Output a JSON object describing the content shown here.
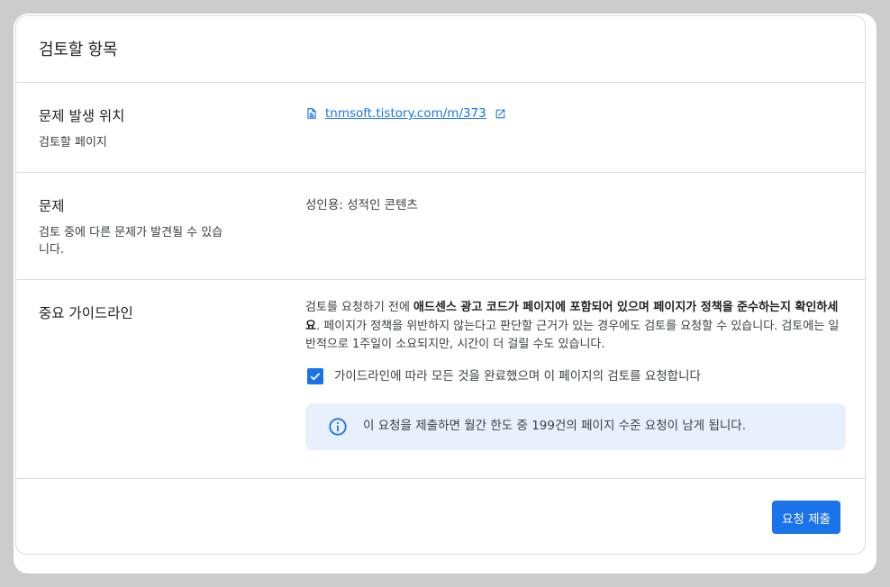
{
  "card": {
    "title": "검토할 항목"
  },
  "location": {
    "label": "문제 발생 위치",
    "sublabel": "검토할 페이지",
    "link_text": "tnmsoft.tistory.com/m/373",
    "doc_icon": "document-icon",
    "external_icon": "open-in-new-icon"
  },
  "issue": {
    "label": "문제",
    "sublabel": "검토 중에 다른 문제가 발견될 수 있습니다.",
    "value": "성인용: 성적인 콘텐츠"
  },
  "guidelines": {
    "label": "중요 가이드라인",
    "text_part1": "검토를 요청하기 전에 ",
    "text_bold": "애드센스 광고 코드가 페이지에 포함되어 있으며 페이지가 정책을 준수하는지 확인하세요",
    "text_part2": ". 페이지가 정책을 위반하지 않는다고 판단할 근거가 있는 경우에도 검토를 요청할 수 있습니다. 검토에는 일반적으로 1주일이 소요되지만, 시간이 더 걸릴 수도 있습니다.",
    "checkbox_label": "가이드라인에 따라 모든 것을 완료했으며 이 페이지의 검토를 요청합니다",
    "checkbox_checked": true,
    "info_icon": "info-icon",
    "info_text": "이 요청을 제출하면 월간 한도 중 199건의 페이지 수준 요청이 남게 됩니다."
  },
  "footer": {
    "submit_label": "요청 제출"
  },
  "colors": {
    "accent": "#1a73e8",
    "info_bg": "#e8f0fe",
    "divider": "#dadce0"
  }
}
